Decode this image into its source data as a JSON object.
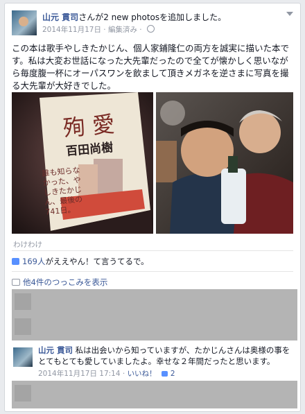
{
  "post": {
    "author": "山元 貫司",
    "action": "さんが2 new photosを追加しました。",
    "date": "2014年11月17日",
    "edited": "· 編集済み ·",
    "text": "この本は歌手やしきたかじん、個人家鋪隆仁の両方を誠実に描いた本です。私は大変お世話になった大先輩だったので全てが懐かしく思いながら毎度腹一杯にオーパスワンを飲まして頂きメガネを逆さまに写真を撮る大先輩が大好きでした。",
    "book_title": "殉 愛",
    "book_author": "百田尚樹",
    "book_band": "誰も知らなかった、やしきたかじん、最後の741日。",
    "photo_caption": "わけわけ"
  },
  "likes": {
    "count": "169人",
    "text": "がええやん！て言うてるで。"
  },
  "comments_link": "他4件のつっこみを表示",
  "comments": [
    {
      "author": "山元 貫司",
      "text": "私は出会いから知っていますが、たかじんさんは奥様の事をとてもとても愛していましたよ。幸せな２年間だったと思います。",
      "time": "2014年11月17日 17:14 ·",
      "like_label": "いいね！",
      "likes": "2"
    }
  ],
  "colors": {
    "link": "#3b5998",
    "meta": "#9197a3",
    "text": "#141823",
    "overlay": "#b4b4b4"
  }
}
